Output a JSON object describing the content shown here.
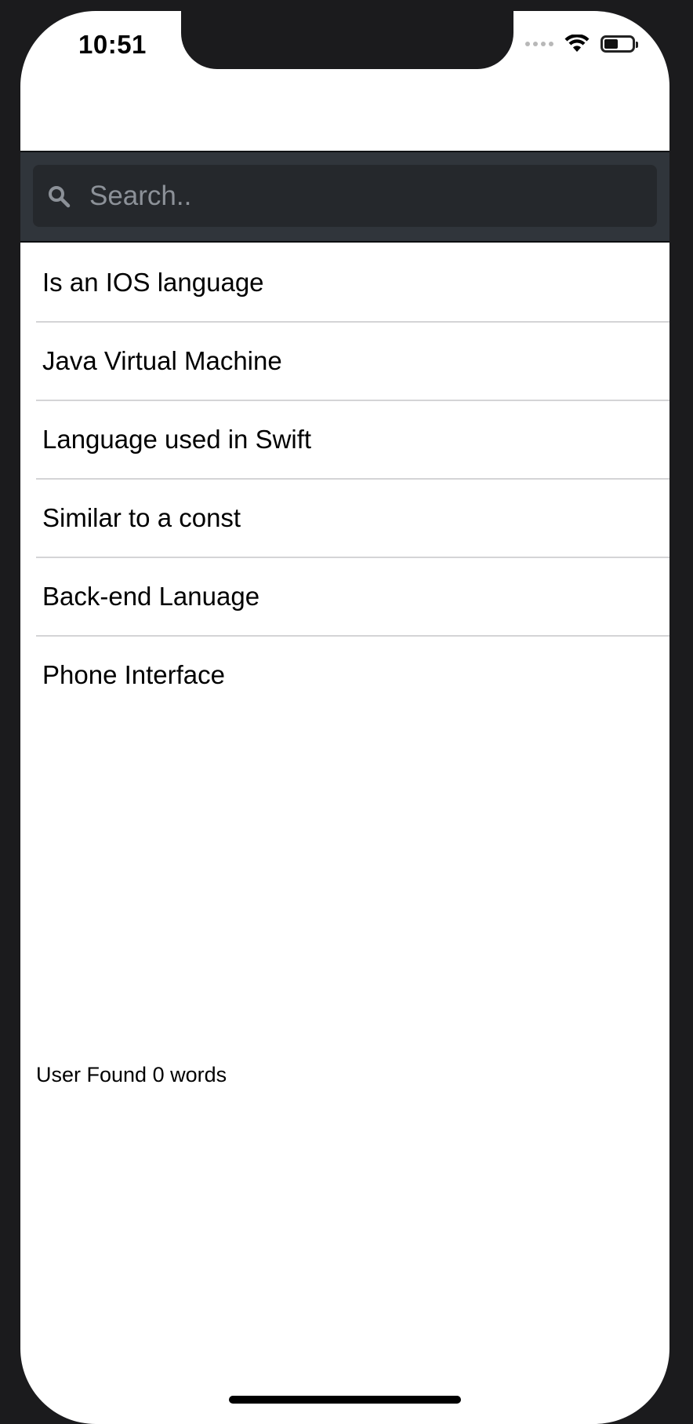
{
  "status_bar": {
    "time": "10:51"
  },
  "search": {
    "placeholder": "Search.."
  },
  "list": {
    "items": [
      {
        "label": "Is an IOS language"
      },
      {
        "label": "Java Virtual Machine"
      },
      {
        "label": "Language used in Swift"
      },
      {
        "label": "Similar to a const"
      },
      {
        "label": "Back-end Lanuage"
      },
      {
        "label": "Phone Interface"
      }
    ]
  },
  "footer": {
    "found_text": "User Found 0 words"
  },
  "colors": {
    "search_bar_bg": "#30353b",
    "search_field_bg": "#25282c",
    "placeholder": "#8c9198",
    "separator": "#d4d4d6"
  },
  "icons": {
    "search": "search-icon",
    "wifi": "wifi-icon",
    "battery": "battery-icon",
    "signal": "signal-icon"
  }
}
